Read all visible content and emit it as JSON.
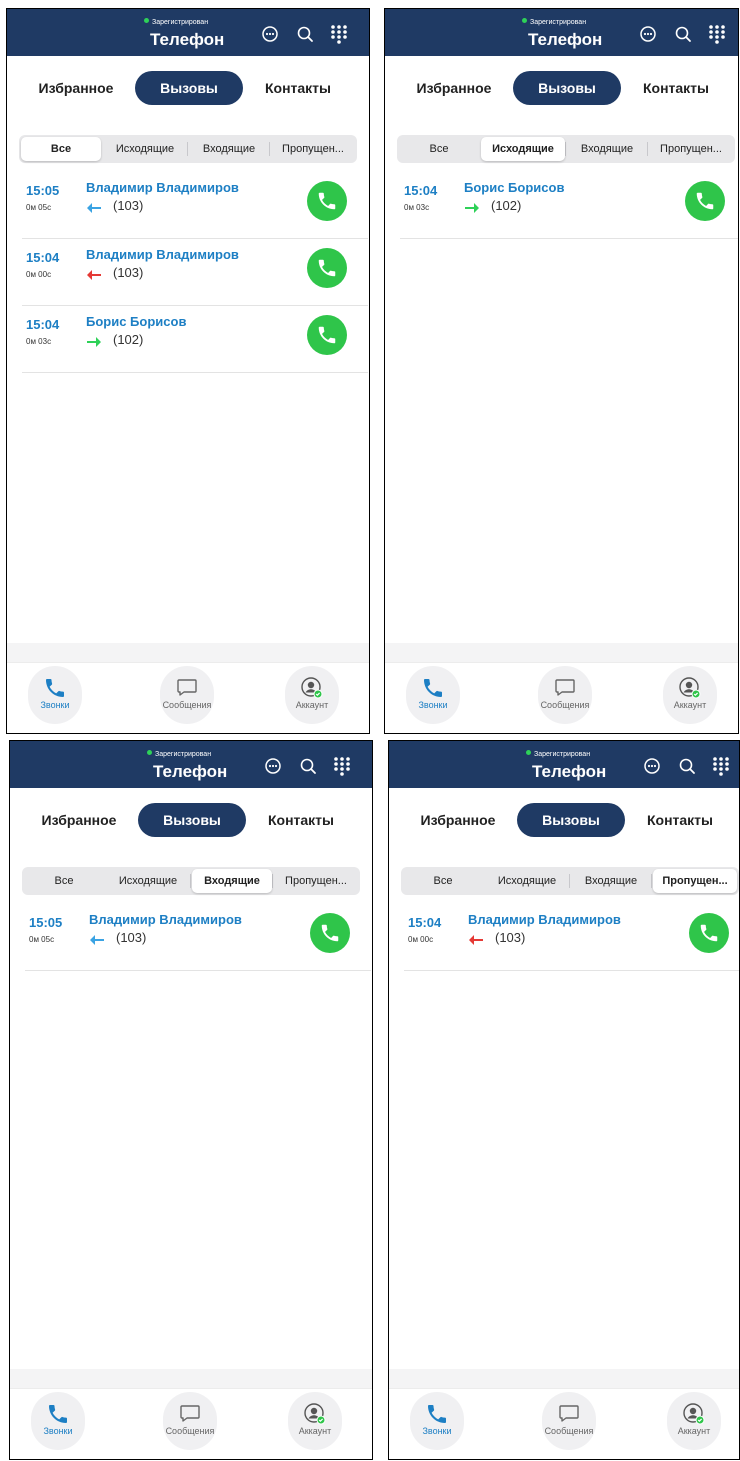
{
  "header": {
    "status": "Зарегистрирован",
    "title": "Телефон"
  },
  "tabs": {
    "favorites": "Избранное",
    "calls": "Вызовы",
    "contacts": "Контакты"
  },
  "filters": [
    "Все",
    "Исходящие",
    "Входящие",
    "Пропущен..."
  ],
  "nav": {
    "calls": "Звонки",
    "messages": "Сообщения",
    "account": "Аккаунт"
  },
  "colors": {
    "accent": "#1f3a64",
    "link": "#1d7fc4",
    "call_green": "#2fc54a",
    "incoming": "#3aa3e3",
    "missed": "#e53935",
    "outgoing": "#2ed158"
  },
  "panels": [
    {
      "selected_filter": 0,
      "calls": [
        {
          "time": "15:05",
          "duration": "0м 05с",
          "name": "Владимир Владимиров",
          "number": "(103)",
          "direction": "incoming"
        },
        {
          "time": "15:04",
          "duration": "0м 00с",
          "name": "Владимир Владимиров",
          "number": "(103)",
          "direction": "missed"
        },
        {
          "time": "15:04",
          "duration": "0м 03с",
          "name": "Борис Борисов",
          "number": "(102)",
          "direction": "outgoing"
        }
      ]
    },
    {
      "selected_filter": 1,
      "calls": [
        {
          "time": "15:04",
          "duration": "0м 03с",
          "name": "Борис Борисов",
          "number": "(102)",
          "direction": "outgoing"
        }
      ]
    },
    {
      "selected_filter": 2,
      "calls": [
        {
          "time": "15:05",
          "duration": "0м 05с",
          "name": "Владимир Владимиров",
          "number": "(103)",
          "direction": "incoming"
        }
      ]
    },
    {
      "selected_filter": 3,
      "calls": [
        {
          "time": "15:04",
          "duration": "0м 00с",
          "name": "Владимир Владимиров",
          "number": "(103)",
          "direction": "missed"
        }
      ]
    }
  ]
}
